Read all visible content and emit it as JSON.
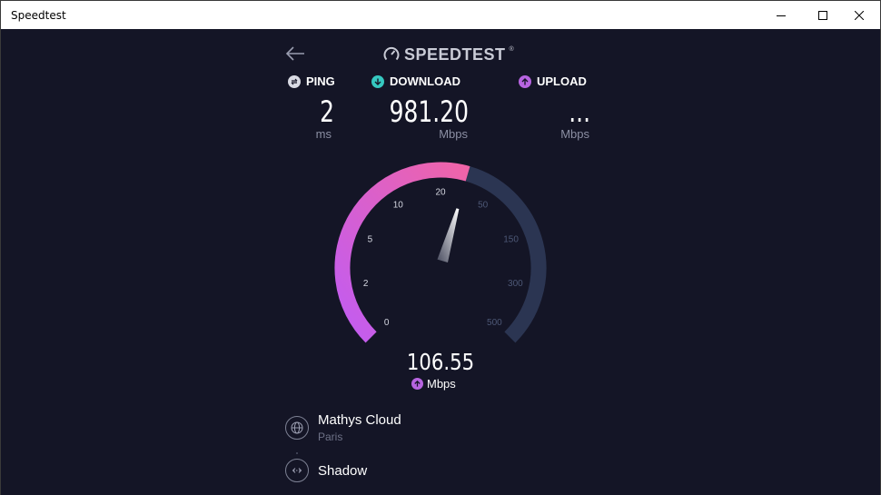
{
  "window": {
    "title": "Speedtest"
  },
  "header": {
    "logo_text": "SPEEDTEST",
    "logo_tm": "®"
  },
  "stats": {
    "ping": {
      "label": "PING",
      "value": "2",
      "unit": "ms",
      "icon": "ping-icon",
      "color": "#ffffff"
    },
    "download": {
      "label": "DOWNLOAD",
      "value": "981.20",
      "unit": "Mbps",
      "icon": "download-arrow-icon",
      "color": "#36c8c0"
    },
    "upload": {
      "label": "UPLOAD",
      "value": "...",
      "unit": "Mbps",
      "icon": "upload-arrow-icon",
      "color": "#b764e0"
    }
  },
  "gauge": {
    "tick_labels": [
      "0",
      "2",
      "5",
      "10",
      "20",
      "50",
      "150",
      "300",
      "500"
    ],
    "current_value": "106.55",
    "current_unit": "Mbps",
    "unit_icon": "upload-arrow-icon",
    "progress_fraction": 0.56,
    "colors": {
      "start": "#c15cf2",
      "end": "#f064a8",
      "track": "#2b3552"
    }
  },
  "server": {
    "host_name": "Mathys Cloud",
    "host_location": "Paris",
    "host_icon": "globe-icon",
    "provider_name": "Shadow",
    "provider_icon": "connection-icon"
  }
}
